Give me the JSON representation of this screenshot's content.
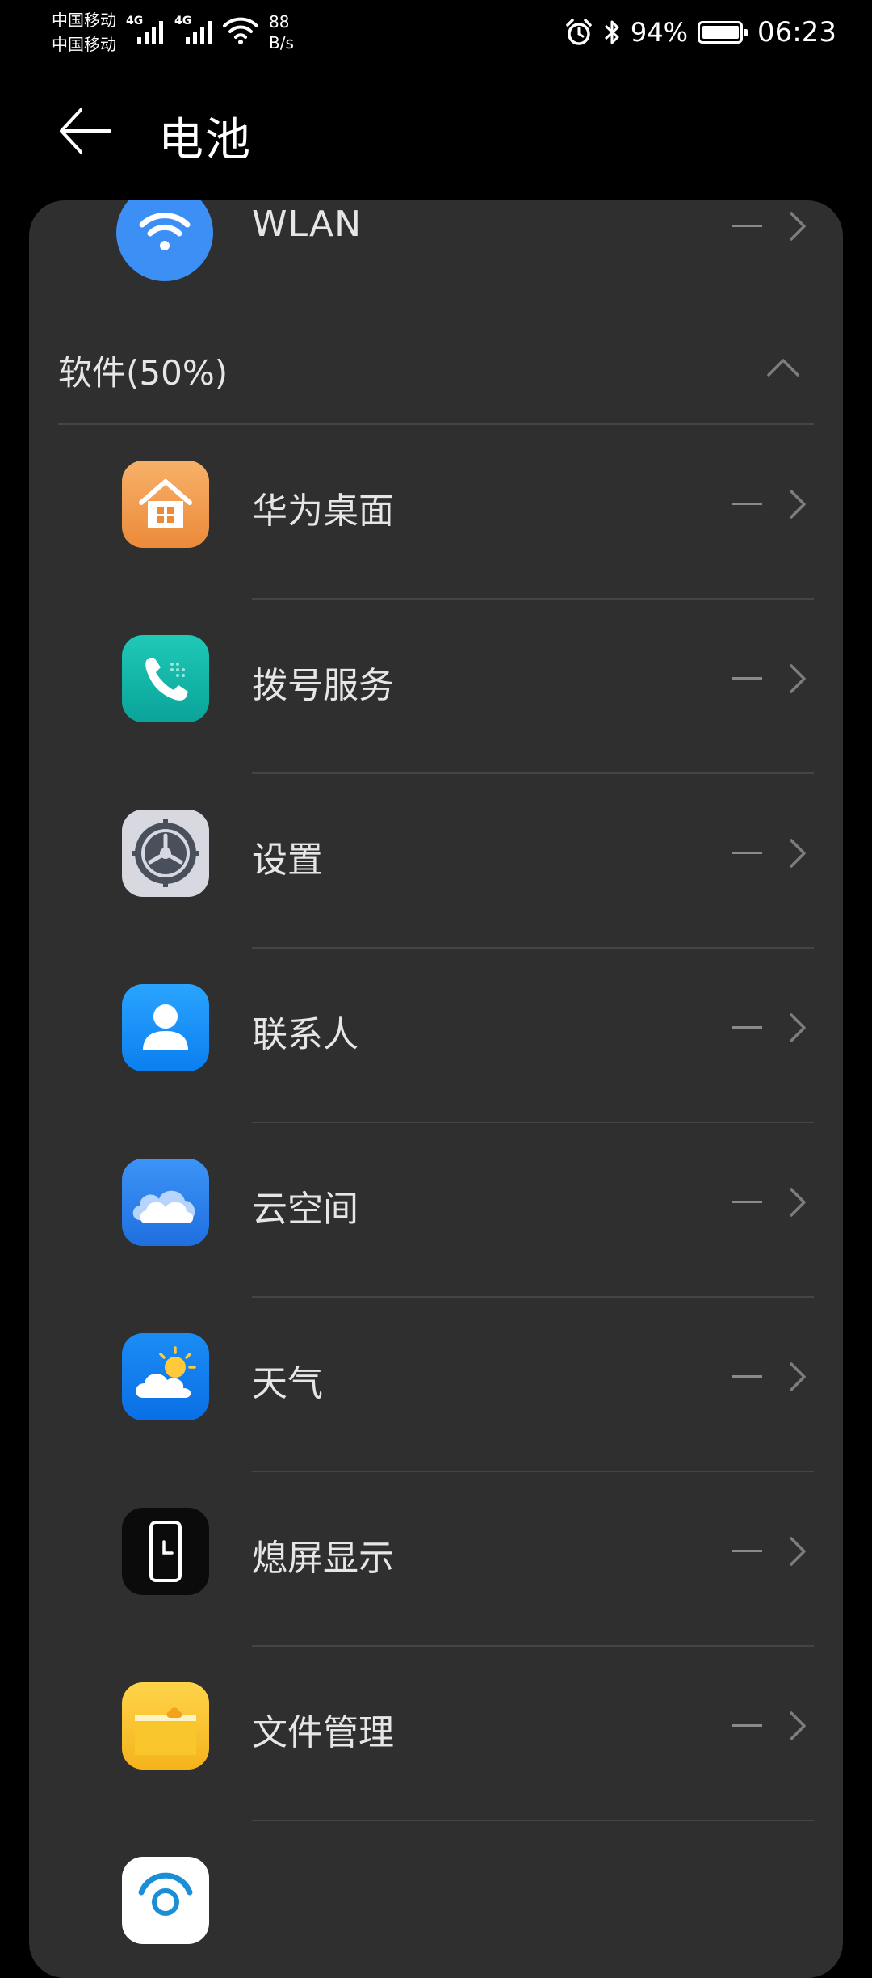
{
  "status_bar": {
    "carrier1": "中国移动",
    "carrier2": "中国移动",
    "network1": "4G",
    "network2": "4G",
    "speed_value": "88",
    "speed_unit": "B/s",
    "battery_pct": "94%",
    "time": "06:23"
  },
  "header": {
    "title": "电池"
  },
  "wlan": {
    "name": "WLAN",
    "value": "—"
  },
  "section": {
    "title": "软件(50%)"
  },
  "apps": [
    {
      "name": "华为桌面",
      "value": "—"
    },
    {
      "name": "拨号服务",
      "value": "—"
    },
    {
      "name": "设置",
      "value": "—"
    },
    {
      "name": "联系人",
      "value": "—"
    },
    {
      "name": "云空间",
      "value": "—"
    },
    {
      "name": "天气",
      "value": "—"
    },
    {
      "name": "熄屏显示",
      "value": "—"
    },
    {
      "name": "文件管理",
      "value": "—"
    }
  ],
  "colors": {
    "background": "#000000",
    "card": "#2f2f2f",
    "wlan_icon": "#3c8ff5"
  },
  "icons": {
    "wlan": "wifi-icon",
    "launcher": "house-icon",
    "dialer": "phone-icon",
    "settings": "gear-icon",
    "contacts": "person-icon",
    "cloud": "cloud-icon",
    "weather": "weather-icon",
    "aod": "clock-phone-icon",
    "files": "folder-icon"
  }
}
